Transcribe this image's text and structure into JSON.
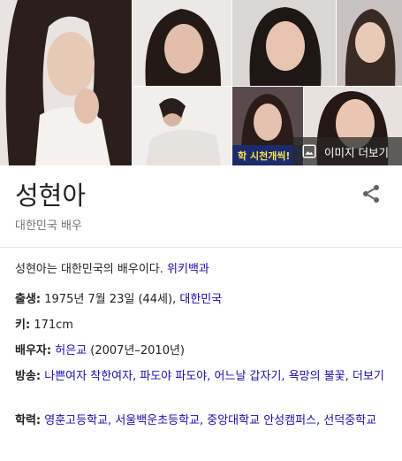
{
  "gallery": {
    "more_images_label": "이미지 더보기",
    "thumb_caption_text": "학 시천개씩!"
  },
  "entity": {
    "name": "성현아",
    "subtitle": "대한민국 배우"
  },
  "description": {
    "text": "성현아는 대한민국의 배우이다.",
    "source_link": "위키백과"
  },
  "facts": {
    "born": {
      "label": "출생:",
      "text": "1975년 7월 23일 (44세),",
      "link": "대한민국"
    },
    "height": {
      "label": "키:",
      "text": "171cm"
    },
    "spouse": {
      "label": "배우자:",
      "link": "허은교",
      "text": "(2007년–2010년)"
    },
    "shows": {
      "label": "방송:",
      "items": [
        "나쁜여자 착한여자,",
        "파도야 파도야,",
        "어느날 갑자기,",
        "욕망의 불꽃,",
        "더보기"
      ]
    },
    "education": {
      "label": "학력:",
      "items": [
        "영훈고등학교,",
        "서울백운초등학교,",
        "중앙대학교 안성캠퍼스,",
        "선덕중학교"
      ]
    }
  },
  "colors": {
    "link": "#1a0dab",
    "muted": "#70757a"
  },
  "icons": [
    "image-icon",
    "share-icon"
  ]
}
